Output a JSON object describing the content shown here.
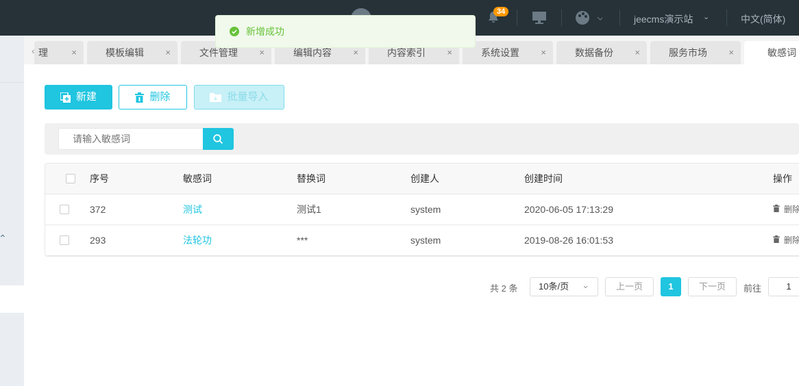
{
  "header": {
    "notification_count": "34",
    "site_name": "jeecms演示站",
    "language": "中文(简体)"
  },
  "toast": {
    "message": "新增成功",
    "color": "#67c23a"
  },
  "tabs": [
    {
      "label": "理"
    },
    {
      "label": "模板编辑"
    },
    {
      "label": "文件管理"
    },
    {
      "label": "编辑内容"
    },
    {
      "label": "内容索引"
    },
    {
      "label": "系统设置"
    },
    {
      "label": "数据备份"
    },
    {
      "label": "服务市场"
    },
    {
      "label": "敏感词",
      "active": true
    }
  ],
  "tab_close": "×",
  "toolbar": {
    "new_label": "新建",
    "delete_label": "删除",
    "import_label": "批量导入"
  },
  "search": {
    "placeholder": "请输入敏感词",
    "value": ""
  },
  "table": {
    "columns": [
      "序号",
      "敏感词",
      "替换词",
      "创建人",
      "创建时间",
      "操作"
    ],
    "rows": [
      {
        "id": "372",
        "word": "测试",
        "replacement": "测试1",
        "creator": "system",
        "created": "2020-06-05 17:13:29",
        "action": "删除"
      },
      {
        "id": "293",
        "word": "法轮功",
        "replacement": "***",
        "creator": "system",
        "created": "2019-08-26 16:01:53",
        "action": "删除"
      }
    ]
  },
  "pagination": {
    "total": "共 2 条",
    "page_size": "10条/页",
    "prev": "上一页",
    "current": "1",
    "next": "下一页",
    "goto_label": "前往",
    "goto_value": "1"
  },
  "colors": {
    "accent": "#20c5e0",
    "header_bg": "#263238"
  }
}
